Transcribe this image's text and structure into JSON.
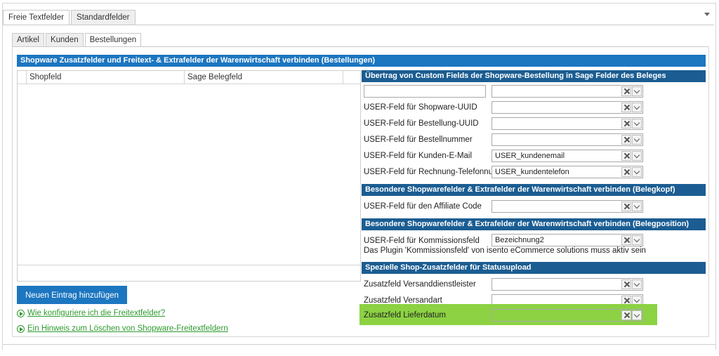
{
  "top_tabs": [
    {
      "label": "Freie Textfelder",
      "active": true
    },
    {
      "label": "Standardfelder",
      "active": false
    }
  ],
  "sub_tabs": [
    {
      "label": "Artikel",
      "active": false
    },
    {
      "label": "Kunden",
      "active": false
    },
    {
      "label": "Bestellungen",
      "active": true
    }
  ],
  "main_header": "Shopware Zusatzfelder und Freitext- & Extrafelder der Warenwirtschaft verbinden (Bestellungen)",
  "grid": {
    "columns": [
      "Shopfeld",
      "Sage Belegfeld"
    ]
  },
  "add_button": "Neuen Eintrag hinzufügen",
  "links": [
    "Wie konfiguriere ich die Freitextfelder?",
    "Ein Hinweis zum Löschen von Shopware-Freitextfeldern"
  ],
  "sections": {
    "custom": {
      "title": "Übertrag von  Custom Fields der Shopware-Bestellung in Sage Felder des Beleges",
      "free_input": {
        "value": "",
        "select_value": ""
      },
      "rows": [
        {
          "label": "USER-Feld für Shopware-UUID",
          "value": ""
        },
        {
          "label": "USER-Feld für Bestellung-UUID",
          "value": ""
        },
        {
          "label": "USER-Feld für Bestellnummer",
          "value": ""
        },
        {
          "label": "USER-Feld für Kunden-E-Mail",
          "value": "USER_kundenemail"
        },
        {
          "label": "USER-Feld für Rechnung-Telefonnummer",
          "value": "USER_kundentelefon"
        }
      ]
    },
    "belegkopf": {
      "title": "Besondere Shopwarefelder & Extrafelder der Warenwirtschaft verbinden (Belegkopf)",
      "rows": [
        {
          "label": "USER-Feld für den Affiliate Code",
          "value": ""
        }
      ]
    },
    "belegposition": {
      "title": "Besondere Shopwarefelder & Extrafelder der Warenwirtschaft verbinden (Belegposition)",
      "rows": [
        {
          "label": "USER-Feld für Kommissionsfeld",
          "value": "Bezeichnung2"
        }
      ],
      "note": "Das Plugin 'Kommissionsfeld' von isento eCommerce solutions muss aktiv sein"
    },
    "statusupload": {
      "title": "Spezielle Shop-Zusatzfelder für Statusupload",
      "rows": [
        {
          "label": "Zusatzfeld Versanddienstleister",
          "value": ""
        },
        {
          "label": "Zusatzfeld Versandart",
          "value": ""
        },
        {
          "label": "Zusatzfeld Lieferdatum",
          "value": ""
        }
      ]
    }
  },
  "colors": {
    "header_blue": "#1c76c0",
    "section_blue": "#1b5d92",
    "highlight_green": "#8cd243",
    "link_green": "#2f9a2f"
  }
}
